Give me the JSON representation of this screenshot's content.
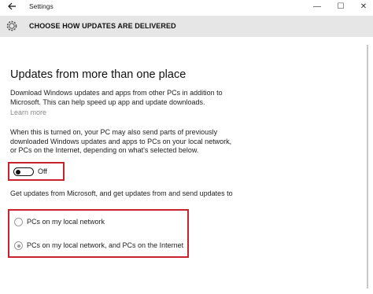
{
  "window": {
    "title": "Settings",
    "controls": {
      "minimize": "—",
      "maximize": "☐",
      "close": "✕"
    }
  },
  "header": {
    "title": "CHOOSE HOW UPDATES ARE DELIVERED"
  },
  "content": {
    "heading": "Updates from more than one place",
    "description": "Download Windows updates and apps from other PCs in addition to Microsoft. This can help speed up app and update downloads.",
    "learn_more": "Learn more",
    "info": "When this is turned on, your PC may also send parts of previously downloaded Windows updates and apps to PCs on your local network, or PCs on the Internet, depending on what's selected below.",
    "toggle": {
      "state_label": "Off",
      "on": false
    },
    "get_updates_text": "Get updates from Microsoft, and get updates from and send updates to",
    "options": [
      {
        "label": "PCs on my local network",
        "selected": false
      },
      {
        "label": "PCs on my local network, and PCs on the Internet",
        "selected": true
      }
    ]
  },
  "colors": {
    "highlight": "#c8232c",
    "header_bg": "#e6e6e6",
    "muted": "#8a8a8a"
  },
  "icons": {
    "back": "back-arrow-icon",
    "settings": "gear-icon"
  }
}
